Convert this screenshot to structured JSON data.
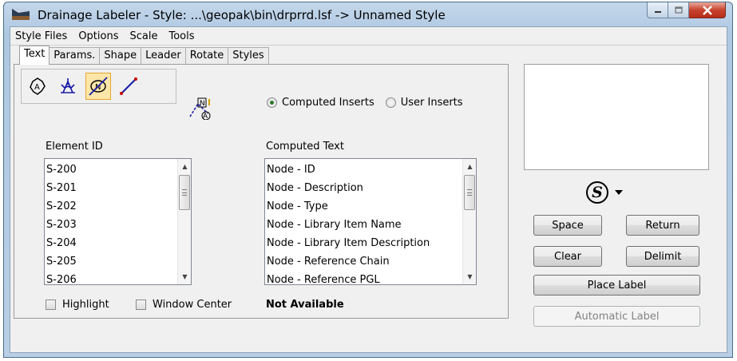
{
  "window": {
    "title": "Drainage Labeler - Style: ...\\geopak\\bin\\drprrd.lsf -> Unnamed Style"
  },
  "menu": [
    {
      "label": "Style Files"
    },
    {
      "label": "Options"
    },
    {
      "label": "Scale"
    },
    {
      "label": "Tools"
    }
  ],
  "tabs": [
    {
      "label": "Text",
      "active": true
    },
    {
      "label": "Params."
    },
    {
      "label": "Shape"
    },
    {
      "label": "Leader"
    },
    {
      "label": "Rotate"
    },
    {
      "label": "Styles"
    }
  ],
  "toolbar": {
    "icons": [
      "area-node-icon",
      "inlet-icon",
      "node-icon",
      "link-icon",
      "profile-label-icon"
    ],
    "active_index": 2
  },
  "insert_mode": {
    "options": [
      {
        "label": "Computed Inserts",
        "checked": true
      },
      {
        "label": "User Inserts",
        "checked": false
      }
    ]
  },
  "element_list": {
    "label": "Element ID",
    "items": [
      "S-200",
      "S-201",
      "S-202",
      "S-203",
      "S-204",
      "S-205",
      "S-206"
    ]
  },
  "computed_list": {
    "label": "Computed Text",
    "items": [
      "Node - ID",
      "Node - Description",
      "Node - Type",
      "Node - Library Item Name",
      "Node - Library Item Description",
      "Node - Reference Chain",
      "Node - Reference PGL"
    ]
  },
  "checkboxes": {
    "highlight": "Highlight",
    "window_center": "Window Center"
  },
  "status": "Not Available",
  "symbol_button": "S",
  "buttons": {
    "space": "Space",
    "return": "Return",
    "clear": "Clear",
    "delimit": "Delimit",
    "place_label": "Place Label",
    "automatic_label": "Automatic Label"
  },
  "colors": {
    "titlebar": "#b9cfe5",
    "active_tool": "#fde6a8",
    "close_button": "#c7432f"
  }
}
